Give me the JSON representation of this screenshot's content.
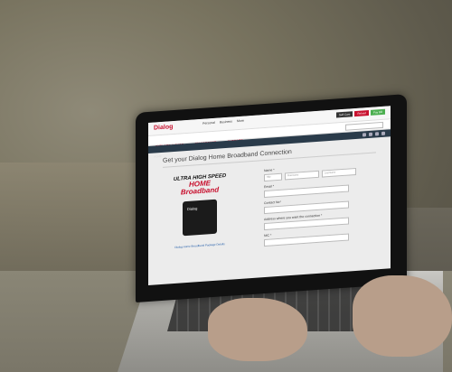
{
  "site": {
    "logo": "Dialog",
    "top_links": [
      "Personal",
      "Business",
      "More"
    ],
    "top_buttons": [
      {
        "label": "Self Care",
        "color": "#333333"
      },
      {
        "label": "Reload",
        "color": "#c8102e"
      },
      {
        "label": "Pay Bill",
        "color": "#4caf50"
      }
    ],
    "nav_items": [
      "EXPLORE & SHOP",
      "MY ACCOUNT",
      "SUPPORT"
    ],
    "breadcrumb": "HOME",
    "page_title": "Get your Dialog Home Broadband Connection",
    "promo": {
      "line1": "ULTRA HIGH SPEED",
      "line2": "HOME",
      "line3": "Broadband",
      "device_label": "Dialog",
      "link": "Dialog Home Broadband Package Details"
    },
    "form": {
      "name_label": "Name *",
      "title_value": "Title",
      "first_name_placeholder": "First Name",
      "last_name_placeholder": "Last Name",
      "email_label": "Email *",
      "contact_label": "Contact No*",
      "address_label": "Address where you want the connection *",
      "nic_label": "NIC *"
    }
  },
  "colors": {
    "brand": "#c8102e",
    "breadcrumb_bar": "#2a3b4a"
  }
}
